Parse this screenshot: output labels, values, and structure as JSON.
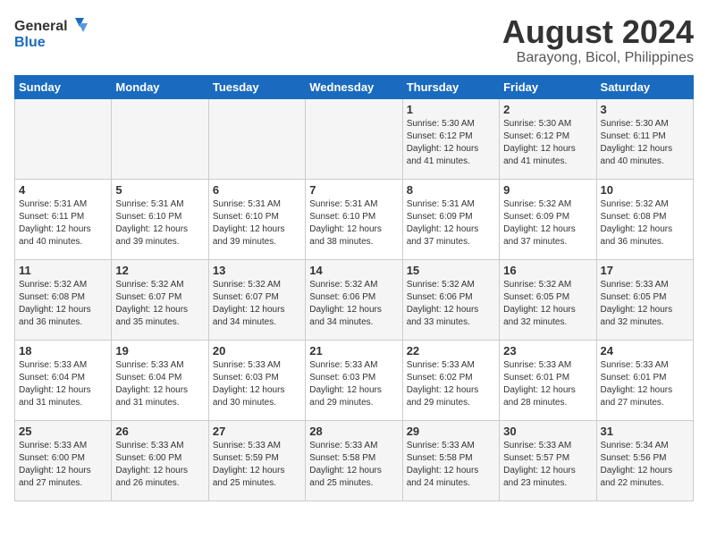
{
  "header": {
    "logo_line1": "General",
    "logo_line2": "Blue",
    "month_year": "August 2024",
    "location": "Barayong, Bicol, Philippines"
  },
  "days_of_week": [
    "Sunday",
    "Monday",
    "Tuesday",
    "Wednesday",
    "Thursday",
    "Friday",
    "Saturday"
  ],
  "weeks": [
    [
      {
        "day": "",
        "info": ""
      },
      {
        "day": "",
        "info": ""
      },
      {
        "day": "",
        "info": ""
      },
      {
        "day": "",
        "info": ""
      },
      {
        "day": "1",
        "info": "Sunrise: 5:30 AM\nSunset: 6:12 PM\nDaylight: 12 hours\nand 41 minutes."
      },
      {
        "day": "2",
        "info": "Sunrise: 5:30 AM\nSunset: 6:12 PM\nDaylight: 12 hours\nand 41 minutes."
      },
      {
        "day": "3",
        "info": "Sunrise: 5:30 AM\nSunset: 6:11 PM\nDaylight: 12 hours\nand 40 minutes."
      }
    ],
    [
      {
        "day": "4",
        "info": "Sunrise: 5:31 AM\nSunset: 6:11 PM\nDaylight: 12 hours\nand 40 minutes."
      },
      {
        "day": "5",
        "info": "Sunrise: 5:31 AM\nSunset: 6:10 PM\nDaylight: 12 hours\nand 39 minutes."
      },
      {
        "day": "6",
        "info": "Sunrise: 5:31 AM\nSunset: 6:10 PM\nDaylight: 12 hours\nand 39 minutes."
      },
      {
        "day": "7",
        "info": "Sunrise: 5:31 AM\nSunset: 6:10 PM\nDaylight: 12 hours\nand 38 minutes."
      },
      {
        "day": "8",
        "info": "Sunrise: 5:31 AM\nSunset: 6:09 PM\nDaylight: 12 hours\nand 37 minutes."
      },
      {
        "day": "9",
        "info": "Sunrise: 5:32 AM\nSunset: 6:09 PM\nDaylight: 12 hours\nand 37 minutes."
      },
      {
        "day": "10",
        "info": "Sunrise: 5:32 AM\nSunset: 6:08 PM\nDaylight: 12 hours\nand 36 minutes."
      }
    ],
    [
      {
        "day": "11",
        "info": "Sunrise: 5:32 AM\nSunset: 6:08 PM\nDaylight: 12 hours\nand 36 minutes."
      },
      {
        "day": "12",
        "info": "Sunrise: 5:32 AM\nSunset: 6:07 PM\nDaylight: 12 hours\nand 35 minutes."
      },
      {
        "day": "13",
        "info": "Sunrise: 5:32 AM\nSunset: 6:07 PM\nDaylight: 12 hours\nand 34 minutes."
      },
      {
        "day": "14",
        "info": "Sunrise: 5:32 AM\nSunset: 6:06 PM\nDaylight: 12 hours\nand 34 minutes."
      },
      {
        "day": "15",
        "info": "Sunrise: 5:32 AM\nSunset: 6:06 PM\nDaylight: 12 hours\nand 33 minutes."
      },
      {
        "day": "16",
        "info": "Sunrise: 5:32 AM\nSunset: 6:05 PM\nDaylight: 12 hours\nand 32 minutes."
      },
      {
        "day": "17",
        "info": "Sunrise: 5:33 AM\nSunset: 6:05 PM\nDaylight: 12 hours\nand 32 minutes."
      }
    ],
    [
      {
        "day": "18",
        "info": "Sunrise: 5:33 AM\nSunset: 6:04 PM\nDaylight: 12 hours\nand 31 minutes."
      },
      {
        "day": "19",
        "info": "Sunrise: 5:33 AM\nSunset: 6:04 PM\nDaylight: 12 hours\nand 31 minutes."
      },
      {
        "day": "20",
        "info": "Sunrise: 5:33 AM\nSunset: 6:03 PM\nDaylight: 12 hours\nand 30 minutes."
      },
      {
        "day": "21",
        "info": "Sunrise: 5:33 AM\nSunset: 6:03 PM\nDaylight: 12 hours\nand 29 minutes."
      },
      {
        "day": "22",
        "info": "Sunrise: 5:33 AM\nSunset: 6:02 PM\nDaylight: 12 hours\nand 29 minutes."
      },
      {
        "day": "23",
        "info": "Sunrise: 5:33 AM\nSunset: 6:01 PM\nDaylight: 12 hours\nand 28 minutes."
      },
      {
        "day": "24",
        "info": "Sunrise: 5:33 AM\nSunset: 6:01 PM\nDaylight: 12 hours\nand 27 minutes."
      }
    ],
    [
      {
        "day": "25",
        "info": "Sunrise: 5:33 AM\nSunset: 6:00 PM\nDaylight: 12 hours\nand 27 minutes."
      },
      {
        "day": "26",
        "info": "Sunrise: 5:33 AM\nSunset: 6:00 PM\nDaylight: 12 hours\nand 26 minutes."
      },
      {
        "day": "27",
        "info": "Sunrise: 5:33 AM\nSunset: 5:59 PM\nDaylight: 12 hours\nand 25 minutes."
      },
      {
        "day": "28",
        "info": "Sunrise: 5:33 AM\nSunset: 5:58 PM\nDaylight: 12 hours\nand 25 minutes."
      },
      {
        "day": "29",
        "info": "Sunrise: 5:33 AM\nSunset: 5:58 PM\nDaylight: 12 hours\nand 24 minutes."
      },
      {
        "day": "30",
        "info": "Sunrise: 5:33 AM\nSunset: 5:57 PM\nDaylight: 12 hours\nand 23 minutes."
      },
      {
        "day": "31",
        "info": "Sunrise: 5:34 AM\nSunset: 5:56 PM\nDaylight: 12 hours\nand 22 minutes."
      }
    ]
  ]
}
